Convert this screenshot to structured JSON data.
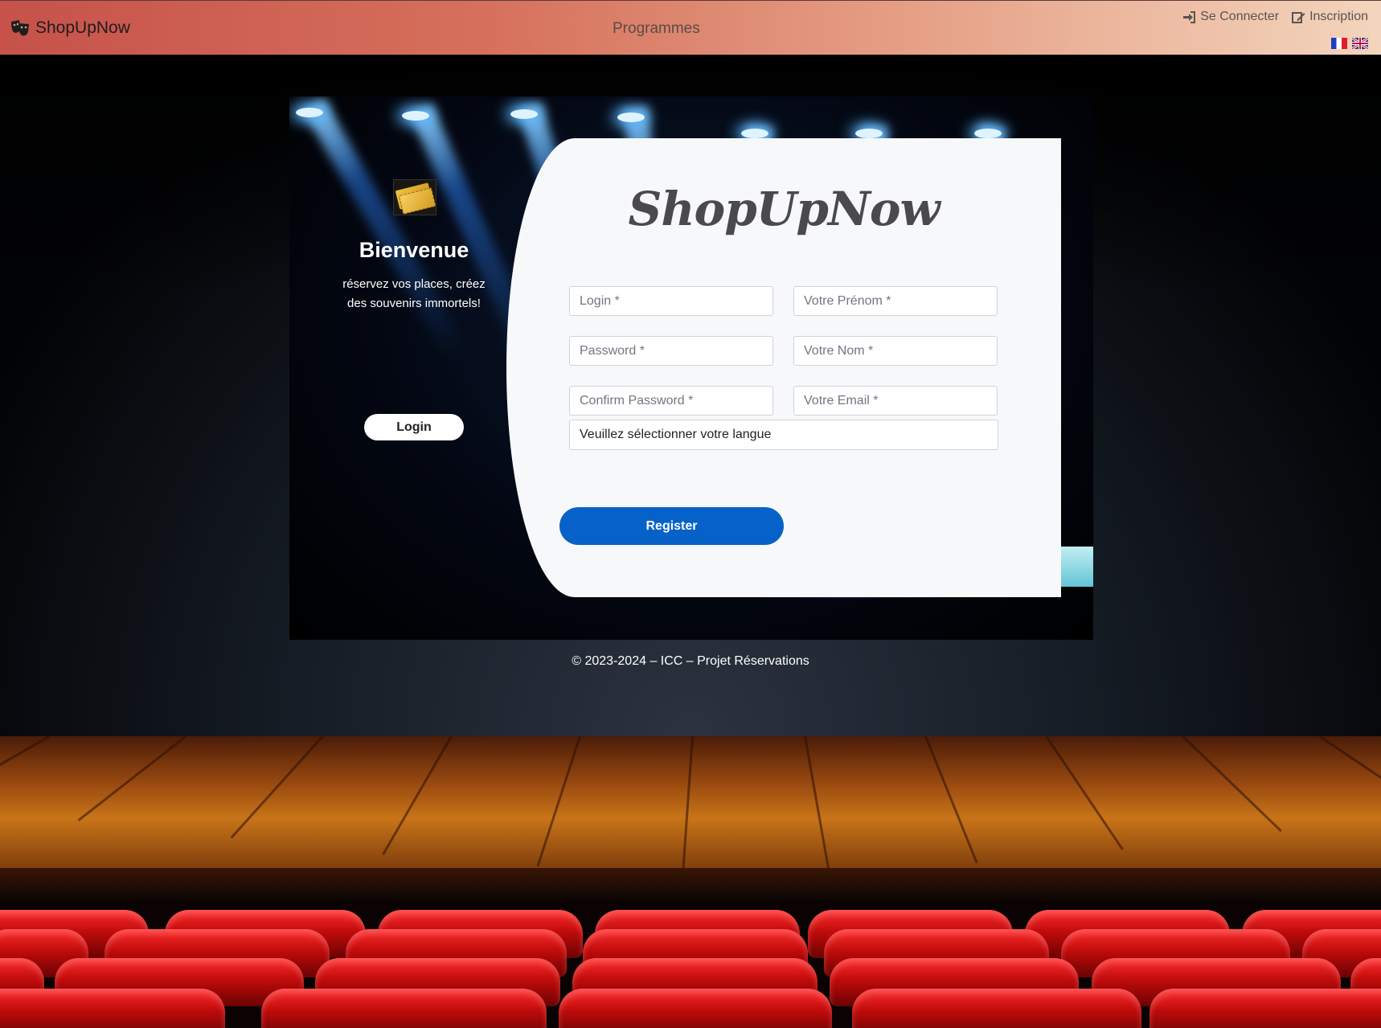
{
  "navbar": {
    "brand": "ShopUpNow",
    "center_link": "Programmes",
    "login_link": "Se Connecter",
    "signup_link": "Inscription",
    "languages": [
      "fr",
      "en"
    ]
  },
  "welcome": {
    "title": "Bienvenue",
    "text": "réservez vos places, créez des souvenirs immortels!",
    "login_button": "Login"
  },
  "form": {
    "logo": "ShopUpNow",
    "login_placeholder": "Login *",
    "firstname_placeholder": "Votre Prénom *",
    "password_placeholder": "Password *",
    "lastname_placeholder": "Votre Nom *",
    "confirm_placeholder": "Confirm Password *",
    "email_placeholder": "Votre Email *",
    "language_select": "Veuillez sélectionner votre langue",
    "register_button": "Register"
  },
  "footer": {
    "text": "© 2023-2024 – ICC – Projet Réservations"
  },
  "colors": {
    "primary": "#0662c8",
    "navbar_start": "#c6524a",
    "navbar_end": "#f3d5bd"
  }
}
